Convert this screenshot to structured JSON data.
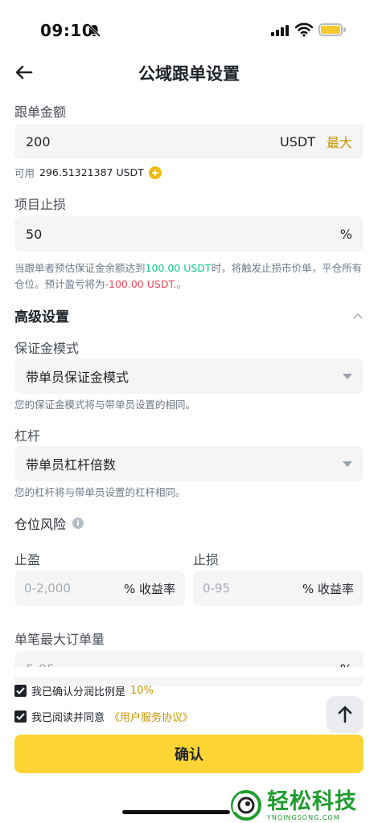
{
  "status_bar": {
    "time": "09:10"
  },
  "header": {
    "title": "公域跟单设置"
  },
  "amount": {
    "label": "跟单金额",
    "value": "200",
    "unit": "USDT",
    "max_label": "最大",
    "available_prefix": "可用",
    "available_value": "296.51321387 USDT"
  },
  "stop_loss": {
    "label": "项目止损",
    "value": "50",
    "unit": "%",
    "hint_1": "当跟单者预估保证金余额达到",
    "hint_green": "100.00 USDT",
    "hint_2": "时，将触发止损市价单，平仓所有仓位。预计盈亏将为",
    "hint_red": "-100.00 USDT.",
    "hint_3": "。"
  },
  "advanced": {
    "label": "高级设置"
  },
  "margin_mode": {
    "label": "保证金模式",
    "value": "带单员保证金模式",
    "hint": "您的保证金模式将与带单员设置的相同。"
  },
  "leverage": {
    "label": "杠杆",
    "value": "带单员杠杆倍数",
    "hint": "您的杠杆将与带单员设置的杠杆相同。"
  },
  "risk": {
    "label": "仓位风险",
    "take_profit_label": "止盈",
    "take_profit_placeholder": "0-2,000",
    "stop_loss_label": "止损",
    "stop_loss_placeholder": "0-95",
    "unit": "% 收益率"
  },
  "max_order": {
    "label": "单笔最大订单量",
    "placeholder": "5-95",
    "unit": "%"
  },
  "agreements": {
    "ratio_text": "我已确认分润比例是",
    "ratio_value": "10%",
    "terms_text": "我已阅读并同意",
    "terms_link": "《用户服务协议》"
  },
  "confirm_label": "确认",
  "watermark": {
    "text": "轻松科技",
    "sub": "YNQINGSONG.COM"
  }
}
